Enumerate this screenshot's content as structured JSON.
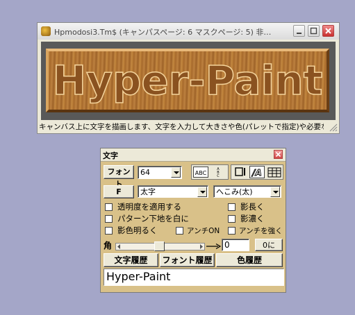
{
  "main_window": {
    "title": "Hpmodosi3.Tm$ (キャンパスページ: 6 マスクページ: 5) 非…",
    "banner_text": "Hyper-Paint",
    "status_text": "キャンバス上に文字を描画します、文字を入力して大きさや色(パレットで指定)や必要な"
  },
  "text_palette": {
    "title": "文字",
    "font_button": "フォント",
    "size_value": "64",
    "f_button": "F",
    "weight_value": "太字",
    "effect_value": "へこみ(太)",
    "options": {
      "apply_transparency": "透明度を適用する",
      "pattern_white": "パターン下地を白に",
      "shadow_light": "影色明るく",
      "antialias_on": "アンチON",
      "shadow_long": "影長く",
      "shadow_dark": "影濃く",
      "antialias_strong": "アンチを強く"
    },
    "angle_label": "角",
    "angle_value": "0",
    "zero_button": "0に",
    "history_buttons": {
      "text": "文字履歴",
      "font": "フォント履歴",
      "color": "色履歴"
    },
    "sample_text": "Hyper-Paint"
  },
  "icons": [
    "app-icon",
    "minimize-icon",
    "maximize-icon",
    "close-icon",
    "horizontal-text-icon",
    "vertical-text-icon",
    "frame-icon",
    "aa-icon",
    "grid-text-icon",
    "arrow-icon",
    "chevron-down-icon",
    "resize-grip-icon"
  ],
  "colors": {
    "desktop": "#a4a6c8",
    "palette_bg": "#d9c189",
    "banner_wood": "#b87a38"
  }
}
